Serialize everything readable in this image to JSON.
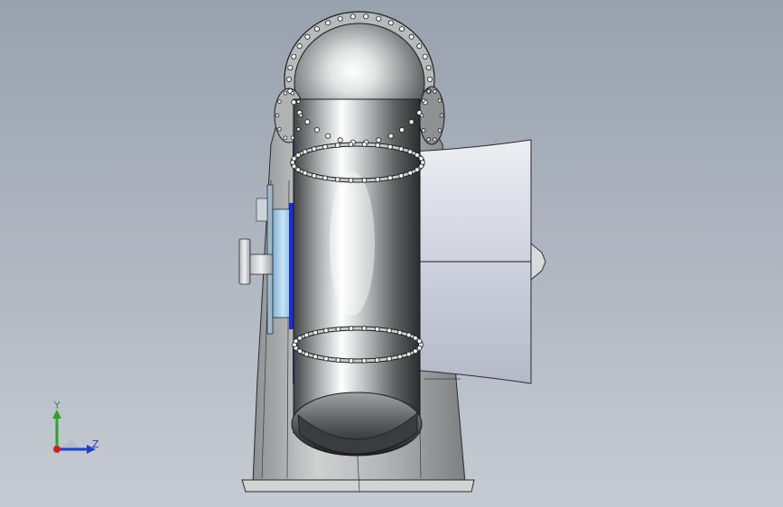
{
  "viewport": {
    "background_top": "#9aa3b0",
    "background_bottom": "#c3c8d1"
  },
  "model": {
    "shell_color": "#b9bcbd",
    "highlight_color": "#f2f3f3",
    "shadow_color": "#2d2f30",
    "bolt_color": "#ffffff",
    "accent_blue": "#1f2bd6",
    "bearing_cyan": "#a9d4f0",
    "outline_color": "#1a1a1a"
  },
  "triad": {
    "y_label": "Y",
    "z_label": "Z",
    "y_color": "#2ea12e",
    "z_color": "#1f3fd0",
    "x_color": "#d01f1f"
  }
}
